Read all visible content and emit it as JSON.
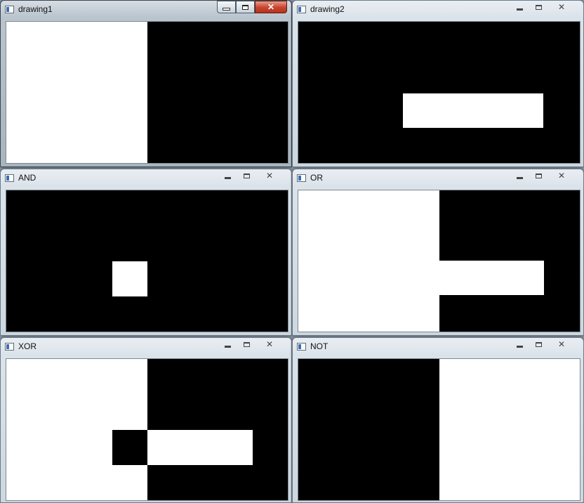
{
  "windows": [
    {
      "id": "drawing1",
      "title": "drawing1",
      "active": true,
      "background": "#000000",
      "shapes": [
        {
          "fill": "#ffffff",
          "rect": "left-half"
        }
      ]
    },
    {
      "id": "drawing2",
      "title": "drawing2",
      "active": false,
      "background": "#000000",
      "shapes": [
        {
          "fill": "#ffffff",
          "rect": "bar"
        }
      ]
    },
    {
      "id": "and",
      "title": "AND",
      "active": false,
      "background": "#000000",
      "shapes": [
        {
          "fill": "#ffffff",
          "rect": "overlap"
        }
      ]
    },
    {
      "id": "or",
      "title": "OR",
      "active": false,
      "background": "#000000",
      "shapes": [
        {
          "fill": "#ffffff",
          "rect": "left-half"
        },
        {
          "fill": "#ffffff",
          "rect": "bar"
        }
      ]
    },
    {
      "id": "xor",
      "title": "XOR",
      "active": false,
      "background": "#ffffff",
      "shapes": [
        {
          "fill": "#000000",
          "rect": "right-half"
        },
        {
          "fill": "#000000",
          "rect": "overlap"
        },
        {
          "fill": "#ffffff",
          "rect": "bar-right-part"
        }
      ]
    },
    {
      "id": "not",
      "title": "NOT",
      "active": false,
      "background": "#000000",
      "shapes": [
        {
          "fill": "#ffffff",
          "rect": "right-half"
        }
      ]
    }
  ],
  "colors": {
    "close_button": "#c7432d",
    "frame_inactive": "#cdd7df",
    "frame_active": "#a8b4be"
  },
  "icons": {
    "window": "window-icon",
    "minimize": "minimize-icon",
    "maximize": "maximize-icon",
    "close": "close-icon"
  }
}
